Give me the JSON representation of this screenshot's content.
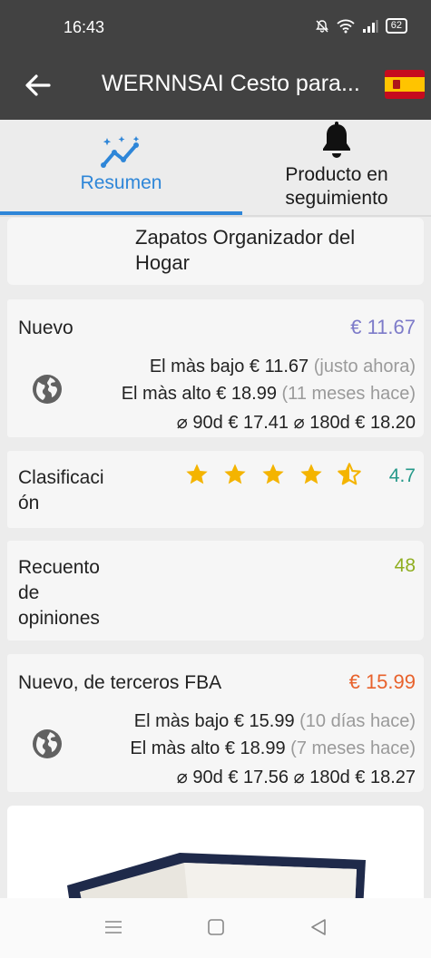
{
  "status_bar": {
    "time": "16:43",
    "battery": "62"
  },
  "app_bar": {
    "title": "WERNNSAI Cesto para..."
  },
  "tabs": [
    {
      "label": "Resumen"
    },
    {
      "label_line1": "Producto en",
      "label_line2": "seguimiento"
    }
  ],
  "product_name": {
    "line1": "Zapatos Organizador del",
    "line2": "Hogar"
  },
  "new_price": {
    "heading": "Nuevo",
    "price": "€ 11.67",
    "lowest_label": "El màs bajo",
    "lowest_value": "€ 11.67",
    "lowest_when": "(justo ahora)",
    "highest_label": "El màs alto",
    "highest_value": "€ 18.99",
    "highest_when": "(11 meses hace)",
    "avg90_label": "⌀ 90d",
    "avg90_value": "€ 17.41",
    "avg180_label": "⌀ 180d",
    "avg180_value": "€ 18.20"
  },
  "rating": {
    "heading_line1": "Clasificaci",
    "heading_line2": "ón",
    "value": "4.7",
    "stars": 4.5,
    "star_color": "#f4b400"
  },
  "reviews": {
    "heading_line1": "Recuento",
    "heading_line2": "de",
    "heading_line3": "opiniones",
    "value": "48"
  },
  "fba_price": {
    "heading": "Nuevo, de terceros FBA",
    "price": "€ 15.99",
    "lowest_label": "El màs bajo",
    "lowest_value": "€ 15.99",
    "lowest_when": "(10 días hace)",
    "highest_label": "El màs alto",
    "highest_value": "€ 18.99",
    "highest_when": "(7 meses hace)",
    "avg90_label": "⌀ 90d",
    "avg90_value": "€ 17.56",
    "avg180_label": "⌀ 180d",
    "avg180_value": "€ 18.27"
  },
  "colors": {
    "header_bg": "#424242",
    "accent_blue": "#2e86d8",
    "new_accent": "#8d86c9",
    "rating_accent": "#26998a",
    "reviews_accent": "#8fbe2a",
    "fba_accent": "#e8703a"
  }
}
